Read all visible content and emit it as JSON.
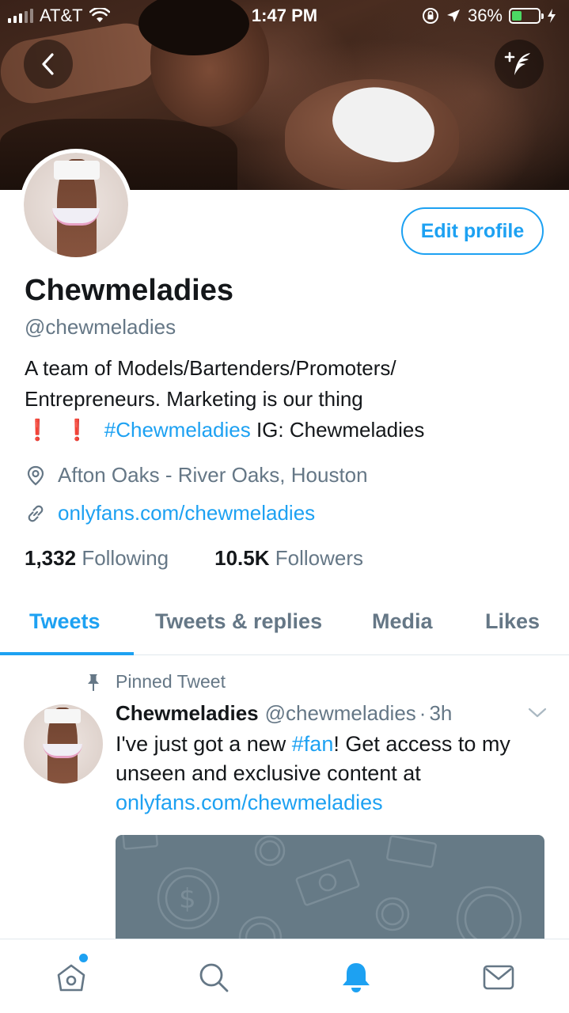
{
  "status_bar": {
    "carrier": "AT&T",
    "time": "1:47 PM",
    "battery_percent": "36%",
    "battery_level": 0.36
  },
  "profile": {
    "display_name": "Chewmeladies",
    "handle": "@chewmeladies",
    "edit_button_label": "Edit profile",
    "bio_line1": "A team of Models/Bartenders/Promoters/",
    "bio_line2": "Entrepreneurs. Marketing is our thing",
    "bio_line3_bang1": "❗",
    "bio_line3_bang2": "❗",
    "bio_hashtag": "#Chewmeladies",
    "bio_ig": " IG: Chewmeladies",
    "location": "Afton Oaks - River Oaks, Houston",
    "website": "onlyfans.com/chewmeladies",
    "following_count": "1,332",
    "following_label": "Following",
    "followers_count": "10.5K",
    "followers_label": "Followers"
  },
  "tabs": [
    {
      "label": "Tweets",
      "active": true
    },
    {
      "label": "Tweets & replies",
      "active": false
    },
    {
      "label": "Media",
      "active": false
    },
    {
      "label": "Likes",
      "active": false
    }
  ],
  "pinned_tweet": {
    "pinned_label": "Pinned Tweet",
    "author_name": "Chewmeladies",
    "author_handle": "@chewmeladies",
    "separator": "·",
    "time_ago": "3h",
    "text_part1": "I've just got a new ",
    "hashtag": "#fan",
    "text_part2": "! Get access to my unseen and exclusive content at ",
    "link": "onlyfans.com/chewmeladies"
  },
  "bottom_nav": {
    "items": [
      "home-icon",
      "search-icon",
      "notifications-icon",
      "messages-icon"
    ],
    "active": "notifications-icon"
  },
  "colors": {
    "accent": "#1da1f2",
    "muted": "#657786",
    "text": "#14171a",
    "battery_green": "#4cd964",
    "media_placeholder": "#667a86"
  }
}
